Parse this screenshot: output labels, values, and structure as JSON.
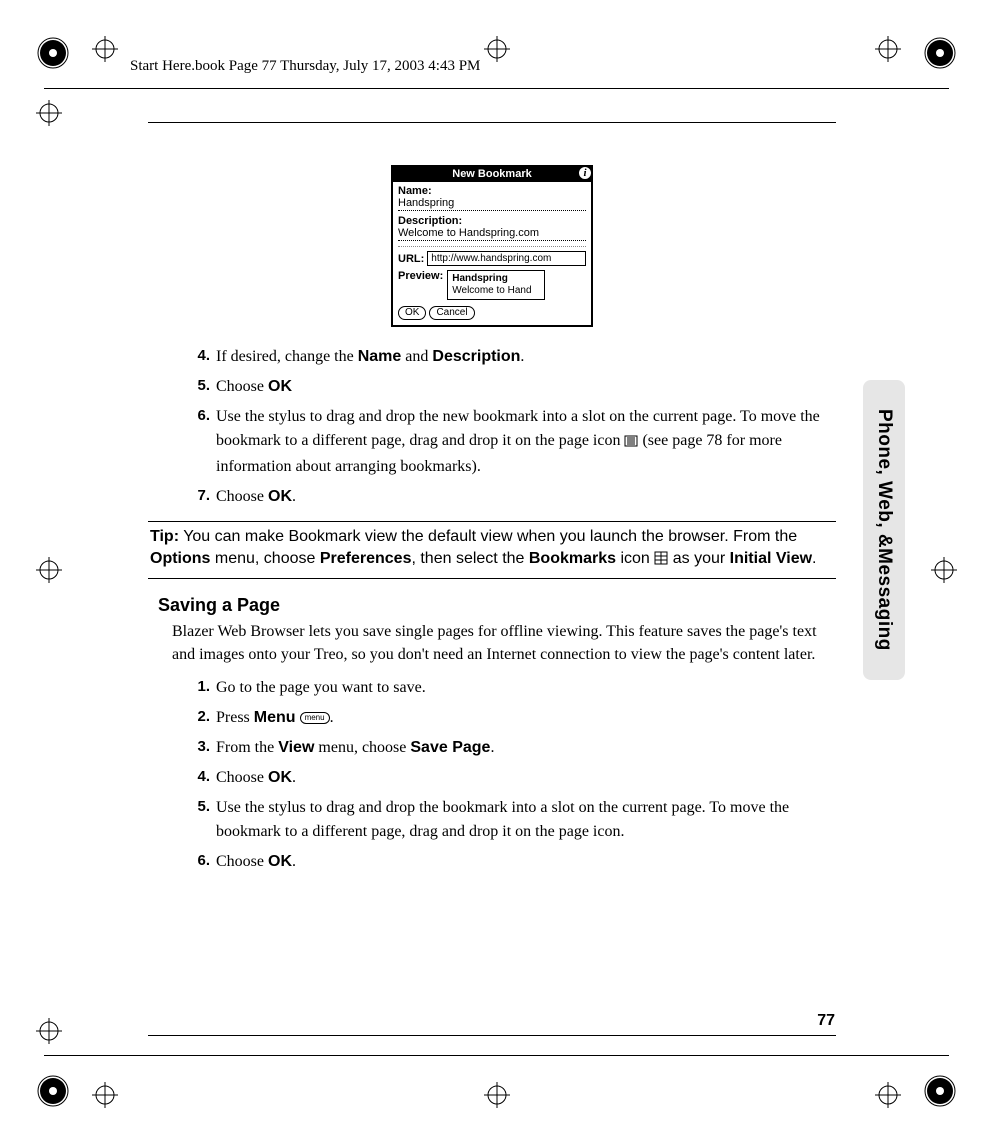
{
  "header": "Start Here.book  Page 77  Thursday, July 17, 2003  4:43 PM",
  "page_number": "77",
  "side_tab": "Phone, Web, &Messaging",
  "palm": {
    "title": "New Bookmark",
    "name_label": "Name:",
    "name_value": "Handspring",
    "desc_label": "Description:",
    "desc_value": "Welcome to Handspring.com",
    "url_label": "URL:",
    "url_value": "http://www.handspring.com",
    "preview_label": "Preview:",
    "preview_l1": "Handspring",
    "preview_l2": "Welcome to Hand",
    "ok": "OK",
    "cancel": "Cancel"
  },
  "steps_a": [
    {
      "n": "4.",
      "pre": "If desired, change the ",
      "b1": "Name",
      "mid": " and ",
      "b2": "Description",
      "post": "."
    },
    {
      "n": "5.",
      "pre": "Choose ",
      "b1": "OK",
      "post": ""
    },
    {
      "n": "6.",
      "text": "Use the stylus to drag and drop the new bookmark into a slot on the current page. To move the bookmark to a different page, drag and drop it on the page icon ",
      "post": " (see page 78 for more information about arranging bookmarks)."
    },
    {
      "n": "7.",
      "pre": "Choose ",
      "b1": "OK",
      "post": "."
    }
  ],
  "tip": {
    "lead": "Tip:",
    "l1": " You can make Bookmark view the default view when you launch the browser. From the ",
    "b1": "Options",
    "l2": " menu, choose ",
    "b2": "Preferences",
    "l3": ", then select the ",
    "b3": "Bookmarks",
    "l4": " icon ",
    "l5": " as your ",
    "b4": "Initial View",
    "l6": "."
  },
  "section": {
    "heading": "Saving a Page",
    "desc": "Blazer Web Browser lets you save single pages for offline viewing. This feature saves the page's text and images onto your Treo, so you don't need an Internet connection to view the page's content later."
  },
  "steps_b": [
    {
      "n": "1.",
      "text": "Go to the page you want to save."
    },
    {
      "n": "2.",
      "pre": "Press ",
      "b1": "Menu",
      "post": " ",
      "menuicon": "menu",
      "post2": "."
    },
    {
      "n": "3.",
      "pre": "From the ",
      "b1": "View",
      "mid": " menu, choose ",
      "b2": "Save Page",
      "post": "."
    },
    {
      "n": "4.",
      "pre": "Choose ",
      "b1": "OK",
      "post": "."
    },
    {
      "n": "5.",
      "text": "Use the stylus to drag and drop the bookmark into a slot on the current page. To move the bookmark to a different page, drag and drop it on the page icon."
    },
    {
      "n": "6.",
      "pre": "Choose ",
      "b1": "OK",
      "post": "."
    }
  ]
}
